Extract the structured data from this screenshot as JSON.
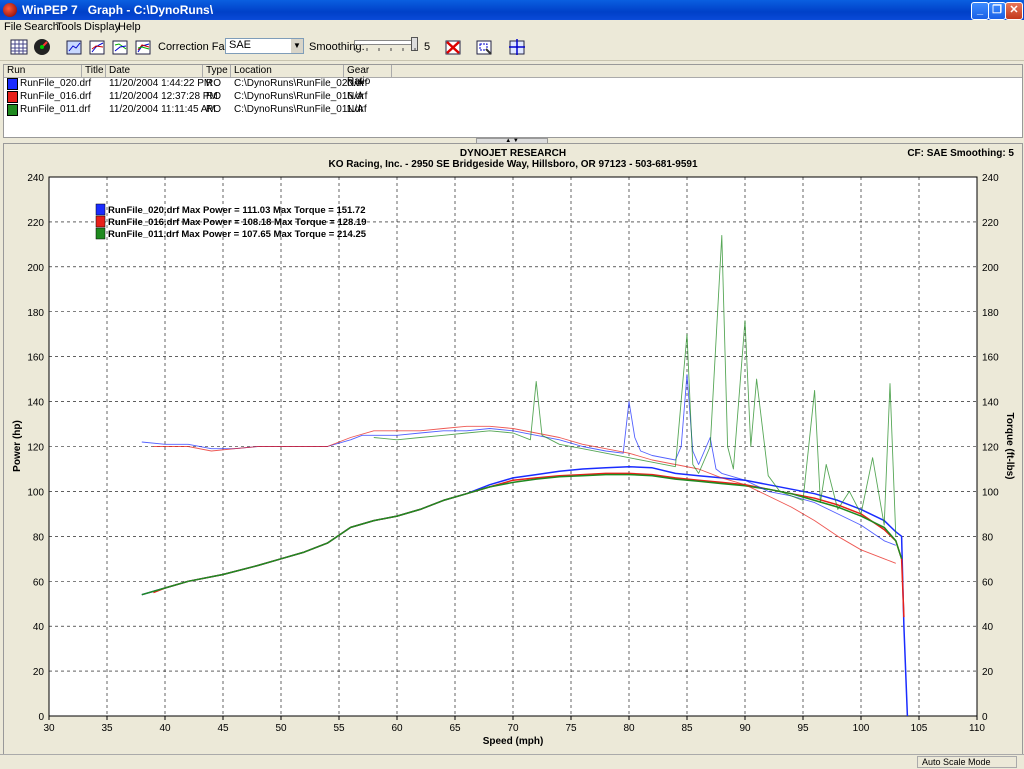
{
  "window": {
    "app_name": "WinPEP 7",
    "title": "Graph - C:\\DynoRuns\\",
    "colors": {
      "titlebar": "#0a4ad8"
    }
  },
  "menu": [
    "File",
    "Search",
    "Tools",
    "Display",
    "Help"
  ],
  "toolbar": {
    "correction_label": "Correction Factor:",
    "correction_value": "SAE",
    "smoothing_label": "Smoothing:",
    "smoothing_value": "5",
    "smoothing_level_fraction": 1.0,
    "icons": [
      "grid-view-icon",
      "gauge-icon",
      "graph-3d-icon",
      "graph-power-icon",
      "graph-torque-icon",
      "graph-overlay-icon",
      "clear-graph-icon",
      "zoom-select-icon",
      "crosshair-icon"
    ]
  },
  "runlist": {
    "columns": [
      "Run",
      "Title",
      "Date",
      "Type",
      "Location",
      "Gear Ratio"
    ],
    "rows": [
      {
        "run": "RunFile_020.drf",
        "title": "",
        "date": "11/20/2004 1:44:22 PM",
        "type": "RO",
        "location": "C:\\DynoRuns\\RunFile_020.drf",
        "gear": "N/A",
        "color": "#1a2cff"
      },
      {
        "run": "RunFile_016.drf",
        "title": "",
        "date": "11/20/2004 12:37:28 PM",
        "type": "RO",
        "location": "C:\\DynoRuns\\RunFile_016.drf",
        "gear": "N/A",
        "color": "#e8201a"
      },
      {
        "run": "RunFile_011.drf",
        "title": "",
        "date": "11/20/2004 11:11:45 AM",
        "type": "RO",
        "location": "C:\\DynoRuns\\RunFile_011.drf",
        "gear": "N/A",
        "color": "#1f8a1f"
      }
    ]
  },
  "graph": {
    "header_title": "DYNOJET RESEARCH",
    "header_sub": "KO Racing, Inc. - 2950 SE Bridgeside Way, Hillsboro, OR 97123 - 503-681-9591",
    "cf_text": "CF: SAE  Smoothing: 5"
  },
  "status": {
    "mode": "Auto Scale Mode"
  },
  "chart_data": {
    "type": "line",
    "xlabel": "Speed (mph)",
    "ylabel": "Power (hp)",
    "ylabel_right": "Torque (ft-lbs)",
    "xlim": [
      30,
      110
    ],
    "ylim": [
      0,
      240
    ],
    "y2lim": [
      0,
      240
    ],
    "x_ticks": [
      30,
      35,
      40,
      45,
      50,
      55,
      60,
      65,
      70,
      75,
      80,
      85,
      90,
      95,
      100,
      105,
      110
    ],
    "y_ticks": [
      0,
      20,
      40,
      60,
      80,
      100,
      120,
      140,
      160,
      180,
      200,
      220,
      240
    ],
    "grid": true,
    "legend_position": "top-left",
    "legend": [
      "RunFile_020.drf Max Power = 111.03 Max Torque = 151.72",
      "RunFile_016.drf Max Power = 108.18 Max Torque = 128.19",
      "RunFile_011.drf Max Power = 107.65 Max Torque = 214.25"
    ],
    "series": [
      {
        "name": "RunFile_020.drf Power",
        "color": "#1a2cff",
        "axis": "left",
        "x": [
          38,
          40,
          42,
          45,
          48,
          50,
          52,
          54,
          56,
          58,
          60,
          62,
          64,
          66,
          68,
          70,
          72,
          74,
          76,
          78,
          80,
          82,
          84,
          86,
          88,
          90,
          92,
          94,
          96,
          98,
          100,
          102,
          103,
          103.5,
          103.7,
          104
        ],
        "y": [
          54,
          57,
          60,
          63,
          67,
          70,
          73,
          77,
          84,
          87,
          89,
          92,
          96,
          99,
          103,
          106,
          107.5,
          109,
          110,
          110.5,
          111,
          110.5,
          108,
          107,
          106,
          105,
          103,
          101,
          99,
          96,
          92,
          87,
          82,
          80,
          40,
          0
        ]
      },
      {
        "name": "RunFile_016.drf Power",
        "color": "#e8201a",
        "axis": "left",
        "x": [
          39,
          40,
          42,
          45,
          48,
          50,
          52,
          54,
          56,
          58,
          60,
          62,
          64,
          66,
          68,
          70,
          72,
          74,
          76,
          78,
          80,
          82,
          84,
          86,
          88,
          90,
          92,
          94,
          96,
          98,
          100,
          102,
          103,
          103.5,
          103.7
        ],
        "y": [
          55,
          57,
          60,
          63,
          67,
          70,
          73,
          77,
          84,
          87,
          89,
          92,
          96,
          99,
          102,
          105,
          106,
          107,
          107.5,
          108,
          108,
          107.5,
          106,
          105,
          104,
          103,
          101,
          99,
          97,
          94,
          90,
          83,
          78,
          70,
          44
        ]
      },
      {
        "name": "RunFile_011.drf Power",
        "color": "#1f8a1f",
        "axis": "left",
        "x": [
          38,
          40,
          42,
          45,
          48,
          50,
          52,
          54,
          56,
          58,
          60,
          62,
          64,
          66,
          68,
          70,
          72,
          74,
          76,
          78,
          80,
          82,
          84,
          86,
          88,
          90,
          92,
          94,
          96,
          98,
          100,
          102,
          103,
          103.5
        ],
        "y": [
          54,
          57,
          60,
          63,
          67,
          70,
          73,
          77,
          84,
          87,
          89,
          92,
          96,
          99,
          102,
          104,
          105.5,
          106.5,
          107,
          107.5,
          107.5,
          107,
          105.5,
          104.5,
          103.5,
          102.5,
          101,
          99,
          96,
          93,
          89,
          84,
          78,
          70
        ]
      },
      {
        "name": "RunFile_020.drf Torque",
        "color": "#1a2cff",
        "axis": "right",
        "dashed": false,
        "x": [
          38,
          40,
          42,
          44,
          46,
          48,
          50,
          52,
          54,
          56,
          57,
          58,
          60,
          62,
          64,
          66,
          68,
          70,
          72,
          74,
          76,
          78,
          79.5,
          80,
          80.5,
          81,
          82,
          84,
          84.5,
          85,
          85.5,
          86,
          87,
          87.5,
          88,
          90,
          92,
          94,
          96,
          98,
          100,
          102,
          103
        ],
        "y": [
          122,
          121,
          121,
          119,
          119,
          120,
          120,
          120,
          120,
          123,
          125,
          125,
          125,
          126,
          127,
          127,
          128,
          127,
          125,
          123,
          120,
          118,
          117,
          140,
          124,
          118,
          116,
          114,
          120,
          152,
          118,
          112,
          124,
          110,
          108,
          105,
          100,
          98,
          95,
          90,
          85,
          78,
          76
        ]
      },
      {
        "name": "RunFile_016.drf Torque",
        "color": "#e8201a",
        "axis": "right",
        "x": [
          39,
          40,
          42,
          44,
          46,
          48,
          50,
          52,
          54,
          56,
          58,
          60,
          62,
          64,
          66,
          68,
          70,
          72,
          74,
          76,
          78,
          80,
          82,
          84,
          86,
          88,
          90,
          92,
          94,
          96,
          98,
          100,
          102,
          103
        ],
        "y": [
          120,
          120,
          120,
          118,
          119,
          120,
          120,
          120,
          120,
          124,
          127,
          127,
          127,
          128,
          129,
          129,
          128,
          126,
          124,
          121,
          119,
          117,
          114,
          112,
          110,
          106,
          103,
          98,
          93,
          87,
          80,
          74,
          70,
          68
        ]
      },
      {
        "name": "RunFile_011.drf Torque",
        "color": "#1f8a1f",
        "axis": "right",
        "x": [
          58,
          60,
          62,
          64,
          66,
          68,
          70,
          71.5,
          72,
          72.5,
          74,
          76,
          78,
          80,
          82,
          84,
          85,
          85.5,
          86,
          87,
          88,
          88.5,
          89,
          90,
          90.5,
          91,
          92,
          93,
          94,
          95,
          96,
          96.5,
          97,
          98,
          99,
          100,
          101,
          102,
          102.5,
          103
        ],
        "y": [
          124,
          123,
          124,
          125,
          126,
          127,
          126,
          123,
          149,
          125,
          121,
          119,
          117,
          115,
          113,
          111,
          170,
          112,
          108,
          120,
          214,
          120,
          110,
          176,
          120,
          150,
          107,
          100,
          98,
          96,
          145,
          95,
          112,
          92,
          100,
          90,
          115,
          85,
          148,
          80
        ]
      }
    ]
  }
}
